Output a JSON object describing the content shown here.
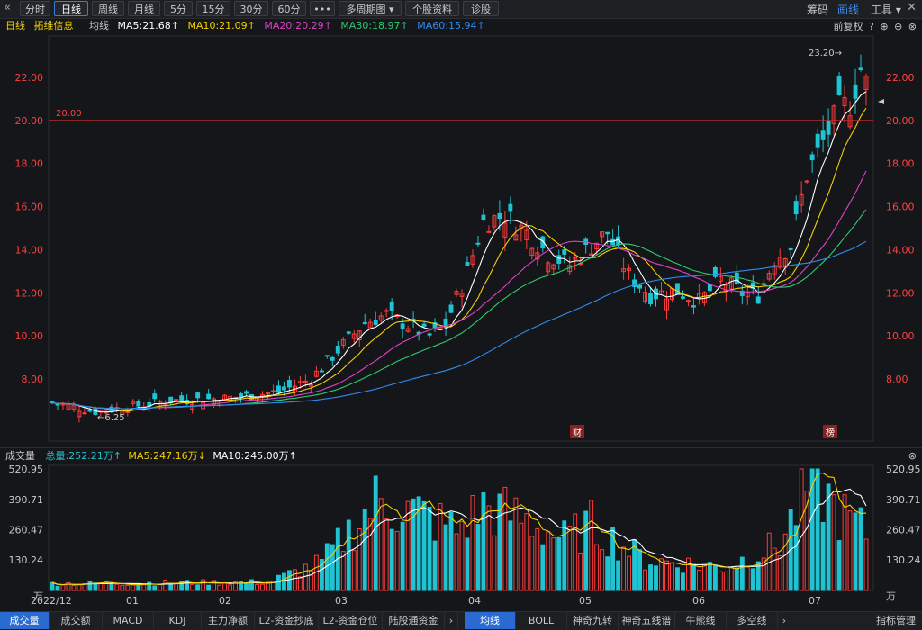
{
  "toolbar": {
    "back_icon": "back-chevron-icon",
    "buttons": [
      "分时",
      "日线",
      "周线",
      "月线",
      "5分",
      "15分",
      "30分",
      "60分",
      "•••",
      "多周期图 ▾",
      "个股资料",
      "诊股"
    ],
    "active_button": "日线",
    "right_items": [
      "筹码",
      "画线",
      "工具 ▾"
    ],
    "active_right": "画线",
    "close_icon": "close-icon"
  },
  "ma_line": {
    "period": "日线",
    "stock_name": "拓维信息",
    "label": "均线",
    "ma5": "MA5:21.68↑",
    "ma10": "MA10:21.09↑",
    "ma20": "MA20:20.29↑",
    "ma30": "MA30:18.97↑",
    "ma60": "MA60:15.94↑",
    "adjust": "前复权"
  },
  "price_chart": {
    "y_ticks": [
      "22.00",
      "20.00",
      "18.00",
      "16.00",
      "14.00",
      "12.00",
      "10.00",
      "8.00"
    ],
    "ref_line_label": "20.00",
    "high_label": "23.20→",
    "low_label": "←6.25",
    "markers": [
      "财",
      "榜"
    ],
    "colors": {
      "up": "#ff3b3b",
      "down": "#1fc3d1",
      "ma5": "#ffffff",
      "ma10": "#f5d000",
      "ma20": "#e040c8",
      "ma30": "#2ecc71",
      "ma60": "#2e8cf0",
      "ref": "#d03030"
    }
  },
  "volume": {
    "title": "成交量",
    "total": "总量:252.21万↑",
    "ma5": "MA5:247.16万↓",
    "ma10": "MA10:245.00万↑",
    "y_ticks": [
      "520.95",
      "390.71",
      "260.47",
      "130.24",
      "万"
    ],
    "x_labels": [
      "2022/12",
      "01",
      "02",
      "03",
      "04",
      "05",
      "06",
      "07"
    ]
  },
  "bottom_tabs_left": [
    "成交量",
    "成交额",
    "MACD",
    "KDJ",
    "主力净额",
    "L2-资金抄底",
    "L2-资金仓位",
    "陆股通资金"
  ],
  "bottom_tabs_right": [
    "均线",
    "BOLL",
    "神奇九转",
    "神奇五线谱",
    "牛熊线",
    "多空线"
  ],
  "bottom_right_button": "指标管理",
  "chart_data": {
    "type": "candlestick",
    "title": "拓维信息 日线",
    "period": "2022/12 - 2023/07",
    "y_range": [
      6.0,
      23.6
    ],
    "ref_line": 20.0,
    "high": 23.2,
    "low": 6.25,
    "ma_latest": {
      "MA5": 21.68,
      "MA10": 21.09,
      "MA20": 20.29,
      "MA30": 18.97,
      "MA60": 15.94
    },
    "volume_unit": "万",
    "volume_latest": {
      "total": 252.21,
      "MA5": 247.16,
      "MA10": 245.0
    },
    "volume_max": 520.95,
    "months": [
      "2022/12",
      "01",
      "02",
      "03",
      "04",
      "05",
      "06",
      "07"
    ]
  }
}
